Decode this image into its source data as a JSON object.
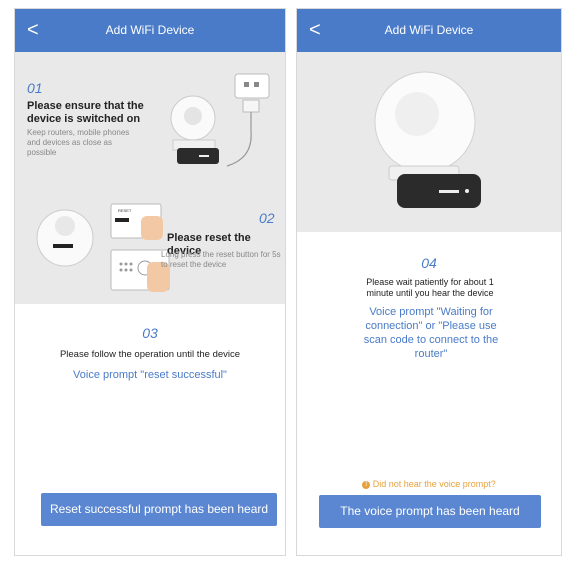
{
  "left": {
    "header": {
      "back": "<",
      "title": "Add WiFi Device"
    },
    "step1": {
      "number": "01",
      "title": "Please ensure that the device is switched on",
      "desc": "Keep routers, mobile phones and devices as close as possible"
    },
    "step2": {
      "number": "02",
      "title": "Please reset the device",
      "desc": "Long press the reset button for 5s to reset the device",
      "reset_label": "RESET"
    },
    "step3": {
      "number": "03",
      "text": "Please follow the operation until the device",
      "voice": "Voice prompt \"reset successful\""
    },
    "button": "Reset successful prompt has been heard"
  },
  "right": {
    "header": {
      "back": "<",
      "title": "Add WiFi Device"
    },
    "step4": {
      "number": "04",
      "text": "Please wait patiently for about 1 minute until you hear the device",
      "voice": "Voice prompt \"Waiting for connection\" or \"Please use scan code to connect to the router\""
    },
    "hint": "Did not hear the voice prompt?",
    "button": "The voice prompt has been heard"
  },
  "colors": {
    "header": "#4a7bc8",
    "button": "#5b87d2",
    "hint": "#e6a23c",
    "grey_panel": "#e9e9e9"
  }
}
